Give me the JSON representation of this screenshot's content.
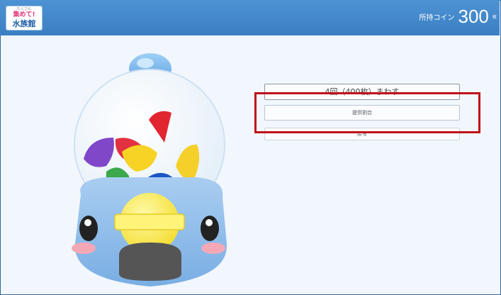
{
  "header": {
    "logo": {
      "small": "たくさん",
      "mid": "集めて!",
      "main": "水族館"
    },
    "coins_label": "所持コイン",
    "coins_value": "300",
    "coins_unit": "枚"
  },
  "actions": {
    "spin_label": "4回（400枚）まわす",
    "rate_label": "提供割合",
    "back_label": "戻る"
  },
  "colors": {
    "header": "#3b7fc2",
    "highlight": "#c0101a"
  },
  "icons": [
    "gacha-machine-icon",
    "capsule-icon",
    "coin-slot-icon"
  ]
}
